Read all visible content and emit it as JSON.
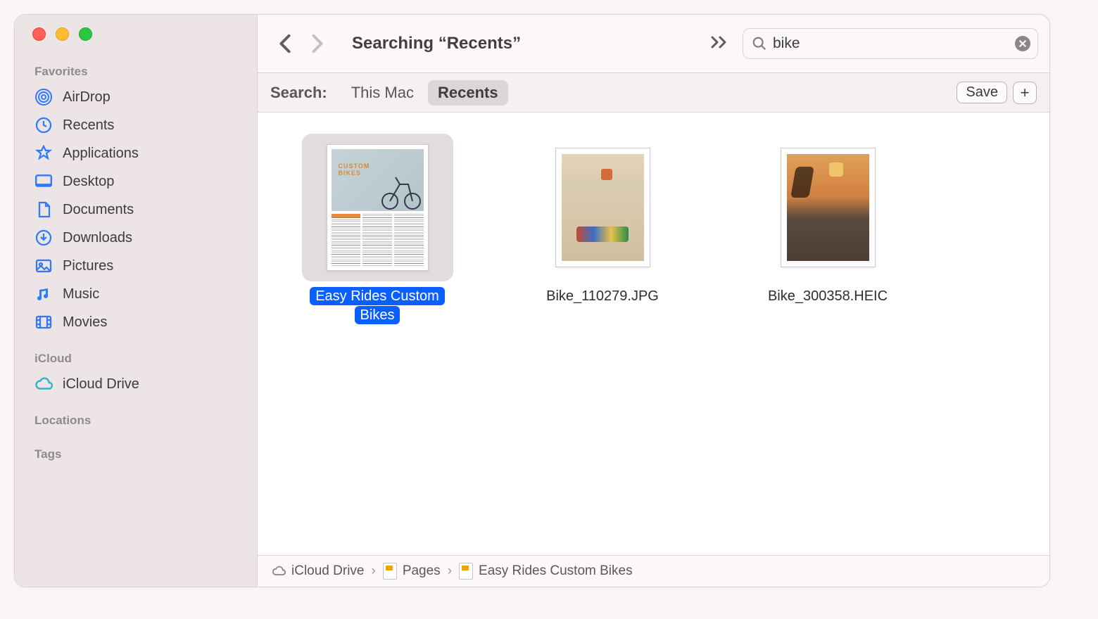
{
  "sidebar": {
    "sections": {
      "favorites": {
        "label": "Favorites"
      },
      "icloud": {
        "label": "iCloud"
      },
      "locations": {
        "label": "Locations"
      },
      "tags": {
        "label": "Tags"
      }
    },
    "items": {
      "airdrop": {
        "label": "AirDrop"
      },
      "recents": {
        "label": "Recents"
      },
      "applications": {
        "label": "Applications"
      },
      "desktop": {
        "label": "Desktop"
      },
      "documents": {
        "label": "Documents"
      },
      "downloads": {
        "label": "Downloads"
      },
      "pictures": {
        "label": "Pictures"
      },
      "music": {
        "label": "Music"
      },
      "movies": {
        "label": "Movies"
      },
      "icloud_drive": {
        "label": "iCloud Drive"
      }
    }
  },
  "toolbar": {
    "title": "Searching “Recents”",
    "search_value": "bike"
  },
  "scope": {
    "label": "Search:",
    "this_mac": "This Mac",
    "recents": "Recents",
    "save": "Save"
  },
  "files": [
    {
      "name": "Easy Rides Custom Bikes",
      "selected": true,
      "kind": "doc",
      "overlay_line1": "CUSTOM",
      "overlay_line2": "BIKES"
    },
    {
      "name": "Bike_110279.JPG",
      "selected": false,
      "kind": "img_a"
    },
    {
      "name": "Bike_300358.HEIC",
      "selected": false,
      "kind": "img_b"
    }
  ],
  "path": {
    "seg1": "iCloud Drive",
    "seg2": "Pages",
    "seg3": "Easy Rides Custom Bikes"
  },
  "colors": {
    "accent": "#0a60ff",
    "sidebar_icon": "#2e79ff"
  }
}
